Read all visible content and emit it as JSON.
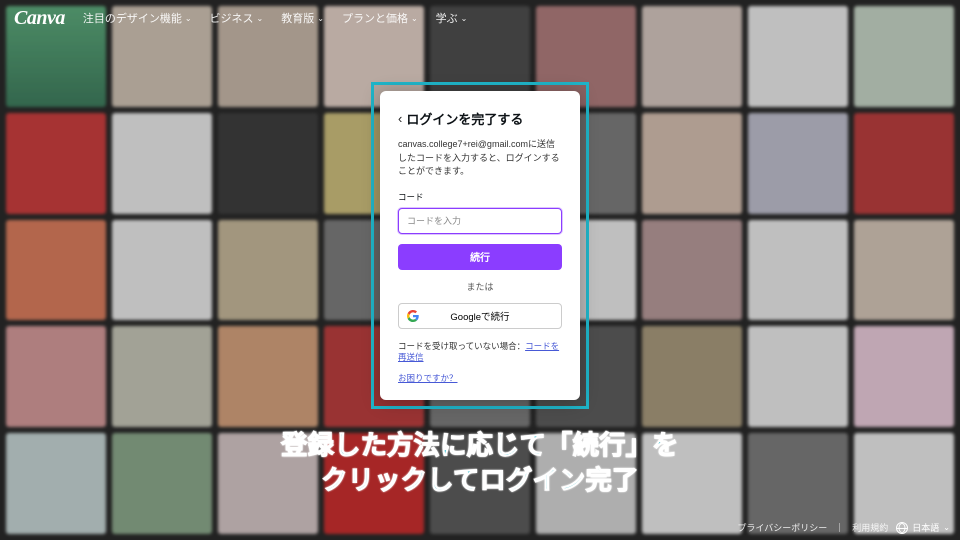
{
  "brand": "Canva",
  "nav": {
    "items": [
      {
        "label": "注目のデザイン機能"
      },
      {
        "label": "ビジネス"
      },
      {
        "label": "教育版"
      },
      {
        "label": "プランと価格"
      },
      {
        "label": "学ぶ"
      }
    ]
  },
  "modal": {
    "title": "ログインを完了する",
    "description": "canvas.college7+rei@gmail.comに送信したコードを入力すると、ログインすることができます。",
    "code_label": "コード",
    "code_placeholder": "コードを入力",
    "continue_label": "続行",
    "separator": "または",
    "google_label": "Googleで続行",
    "resend_prefix": "コードを受け取っていない場合：",
    "resend_link": "コードを再送信",
    "help_link": "お困りですか？"
  },
  "caption": {
    "line1": "登録した方法に応じて「続行」を",
    "line2": "クリックしてログイン完了"
  },
  "footer": {
    "privacy": "プライバシーポリシー",
    "terms": "利用規約",
    "language": "日本語"
  }
}
